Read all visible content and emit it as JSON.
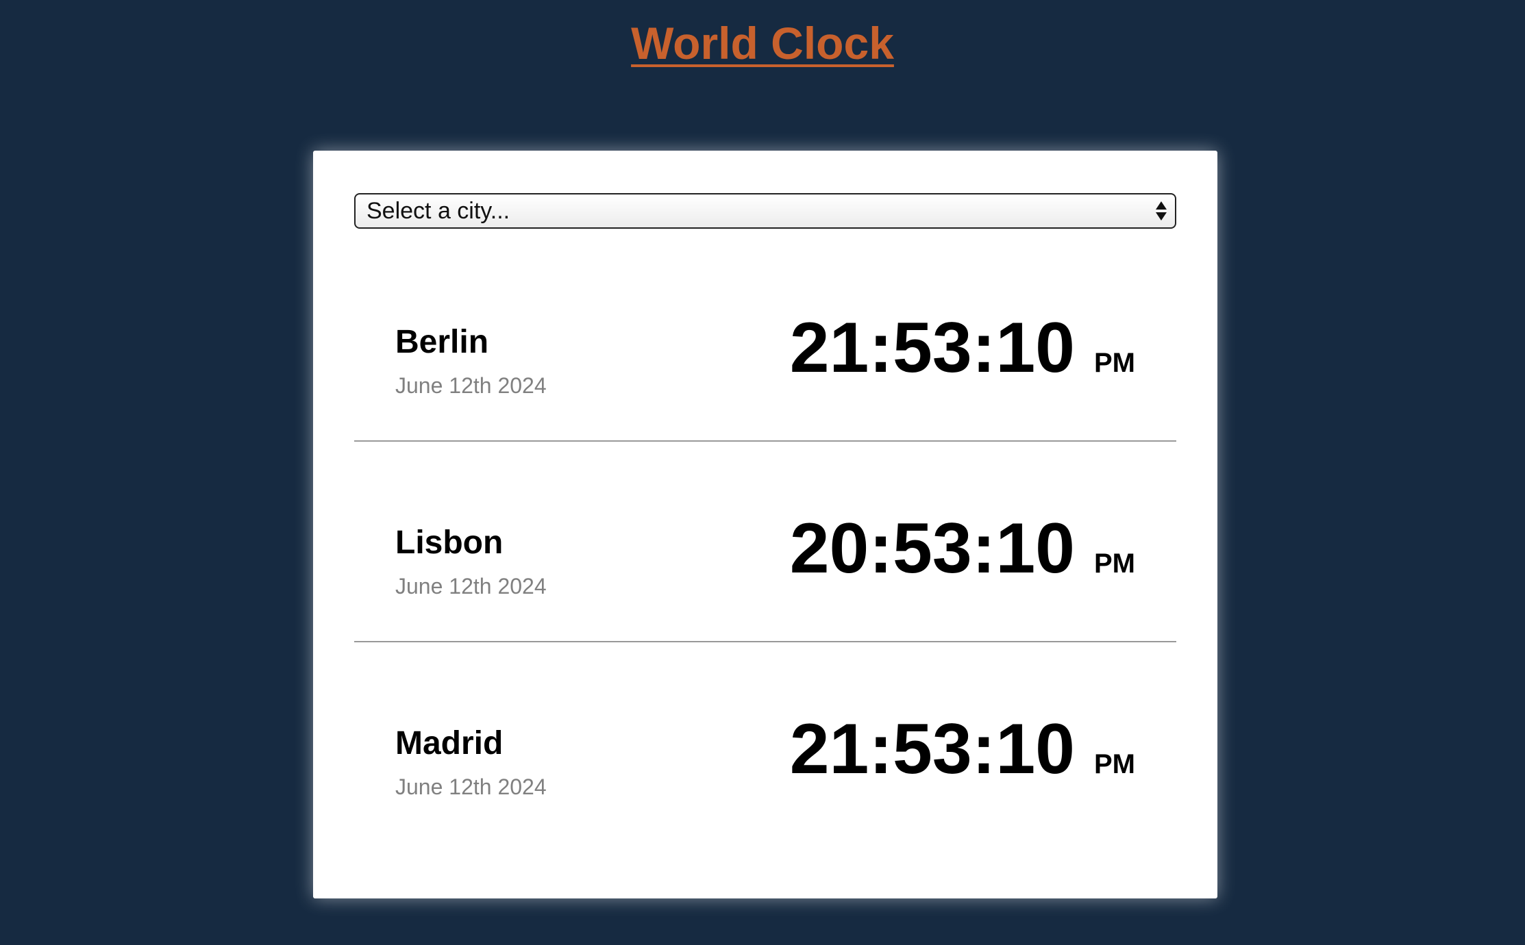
{
  "page": {
    "title": "World Clock"
  },
  "colors": {
    "background": "#162a41",
    "title": "#c8612d",
    "card": "#ffffff",
    "date_text": "#808080"
  },
  "city_select": {
    "placeholder": "Select a city..."
  },
  "cities": [
    {
      "name": "Berlin",
      "date": "June 12th 2024",
      "time": "21:53:10",
      "meridiem": "PM"
    },
    {
      "name": "Lisbon",
      "date": "June 12th 2024",
      "time": "20:53:10",
      "meridiem": "PM"
    },
    {
      "name": "Madrid",
      "date": "June 12th 2024",
      "time": "21:53:10",
      "meridiem": "PM"
    }
  ]
}
